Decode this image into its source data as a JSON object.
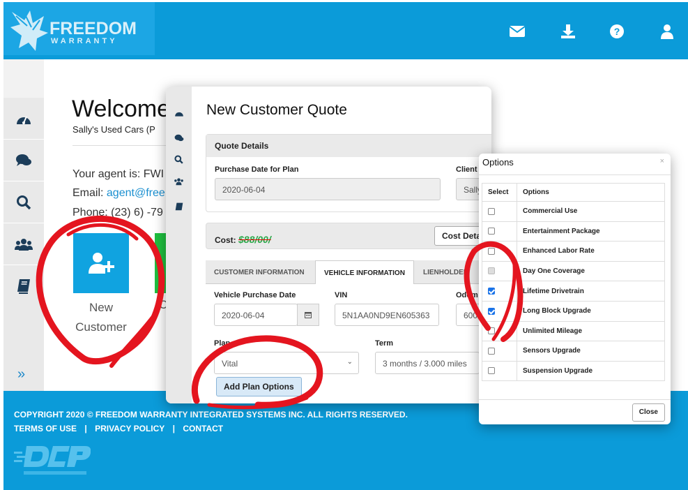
{
  "header": {
    "brand_line1": "FREEDOM",
    "brand_line2": "WARRANTY",
    "icons": [
      "mail-icon",
      "download-icon",
      "help-icon",
      "user-icon"
    ],
    "color": "#0b9bd9"
  },
  "sidebar": {
    "items": [
      "dashboard-icon",
      "chat-icon",
      "search-icon",
      "users-icon",
      "book-icon"
    ],
    "expand": "»"
  },
  "main": {
    "welcome": "Welcome",
    "dealer": "Sally's Used Cars (P",
    "agent": "Your agent is: FWI",
    "email_label": "Email: ",
    "email_value": "agent@free",
    "phone": "Phone: (23) 6) -79",
    "tile_label_line1": "New",
    "tile_label_line2": "Customer",
    "tile2_label": "C"
  },
  "quote_modal": {
    "title": "New Customer Quote",
    "quote_details": {
      "heading": "Quote Details",
      "purchase_date_label": "Purchase Date for Plan",
      "purchase_date_value": "2020-06-04",
      "client_label": "Client",
      "client_value": "Sally"
    },
    "cost": {
      "label": "Cost:",
      "value": "$88/00/",
      "details_button": "Cost Detail"
    },
    "tabs": [
      {
        "label": "CUSTOMER INFORMATION",
        "active": false
      },
      {
        "label": "VEHICLE INFORMATION",
        "active": true
      },
      {
        "label": "LIENHOLDER",
        "active": false
      }
    ],
    "vehicle": {
      "purchase_date_label": "Vehicle Purchase Date",
      "purchase_date_value": "2020-06-04",
      "vin_label": "VIN",
      "vin_value": "5N1AA0ND9EN605363",
      "odometer_label": "Odom",
      "odometer_value": "600",
      "plan_label": "Plan",
      "plan_value": "Vital",
      "term_label": "Term",
      "term_value": "3 months / 3.000 miles",
      "add_options_button": "Add Plan Options"
    }
  },
  "options_modal": {
    "title": "Options",
    "close_x": "×",
    "headers": [
      "Select",
      "Options"
    ],
    "rows": [
      {
        "label": "Commercial Use",
        "state": "unchecked"
      },
      {
        "label": "Entertainment Package",
        "state": "unchecked"
      },
      {
        "label": "Enhanced Labor Rate",
        "state": "unchecked"
      },
      {
        "label": "Day One Coverage",
        "state": "disabled"
      },
      {
        "label": "Lifetime Drivetrain",
        "state": "checked"
      },
      {
        "label": "Long Block Upgrade",
        "state": "checked"
      },
      {
        "label": "Unlimited Mileage",
        "state": "unchecked"
      },
      {
        "label": "Sensors Upgrade",
        "state": "unchecked"
      },
      {
        "label": "Suspension Upgrade",
        "state": "unchecked"
      }
    ],
    "close_button": "Close"
  },
  "footer": {
    "copyright": "COPYRIGHT 2020 © FREEDOM WARRANTY INTEGRATED SYSTEMS INC. ALL RIGHTS RESERVED.",
    "links": [
      "TERMS OF USE",
      "|",
      "PRIVACY POLICY",
      "|",
      "CONTACT"
    ],
    "partner_logo": "DCP"
  }
}
